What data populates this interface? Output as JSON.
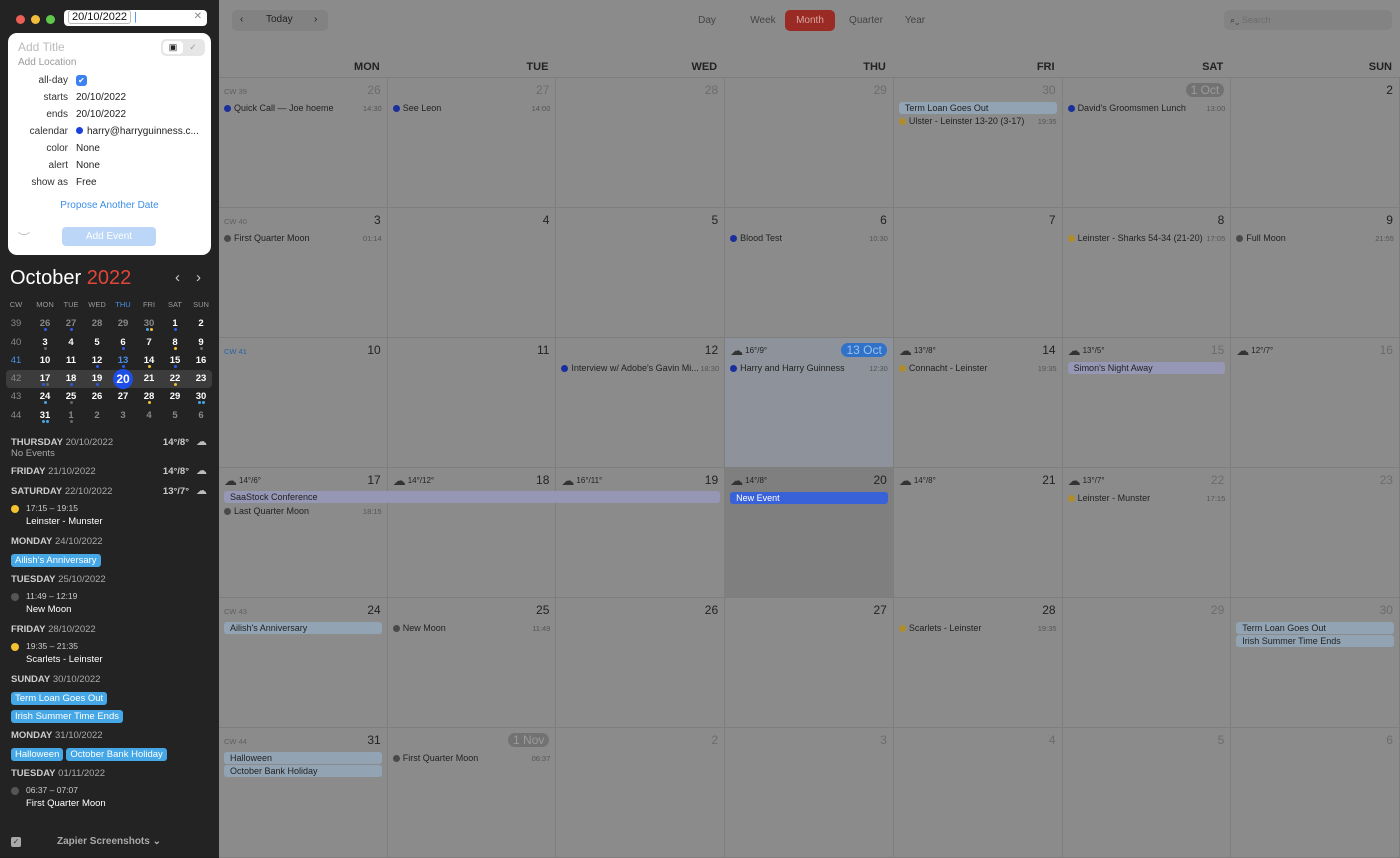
{
  "window": {
    "date_field": "20/10/2022"
  },
  "popup": {
    "title_placeholder": "Add Title",
    "location_placeholder": "Add Location",
    "fields": [
      {
        "label": "all-day",
        "value": "✔"
      },
      {
        "label": "starts",
        "value": "20/10/2022"
      },
      {
        "label": "ends",
        "value": "20/10/2022"
      },
      {
        "label": "calendar",
        "value": "harry@harryguinness.c..."
      },
      {
        "label": "color",
        "value": "None"
      },
      {
        "label": "alert",
        "value": "None"
      },
      {
        "label": "show as",
        "value": "Free"
      }
    ],
    "calendar_color": "#1a3fe0",
    "propose": "Propose Another Date",
    "add_event": "Add Event"
  },
  "mini": {
    "month": "October",
    "year": "2022",
    "headers": [
      "CW",
      "MON",
      "TUE",
      "WED",
      "THU",
      "FRI",
      "SAT",
      "SUN"
    ],
    "rows": [
      {
        "cw": "39",
        "days": [
          {
            "n": "26",
            "m": 1,
            "dots": [
              "#2f5be6"
            ]
          },
          {
            "n": "27",
            "m": 1,
            "dots": [
              "#2f5be6"
            ]
          },
          {
            "n": "28",
            "m": 1
          },
          {
            "n": "29",
            "m": 1
          },
          {
            "n": "30",
            "m": 1,
            "dots": [
              "#45a7e6",
              "#f2c230"
            ]
          },
          {
            "n": "1",
            "dots": [
              "#2f5be6"
            ]
          },
          {
            "n": "2"
          }
        ]
      },
      {
        "cw": "40",
        "days": [
          {
            "n": "3",
            "dots": [
              "#666"
            ]
          },
          {
            "n": "4"
          },
          {
            "n": "5"
          },
          {
            "n": "6",
            "dots": [
              "#2f5be6"
            ]
          },
          {
            "n": "7"
          },
          {
            "n": "8",
            "dots": [
              "#f2c230"
            ]
          },
          {
            "n": "9",
            "dots": [
              "#666"
            ]
          }
        ]
      },
      {
        "cw": "41",
        "days": [
          {
            "n": "10"
          },
          {
            "n": "11"
          },
          {
            "n": "12",
            "dots": [
              "#2f5be6"
            ]
          },
          {
            "n": "13",
            "dots": [
              "#2f5be6"
            ]
          },
          {
            "n": "14",
            "dots": [
              "#f2c230"
            ]
          },
          {
            "n": "15",
            "dots": [
              "#2f5be6"
            ]
          },
          {
            "n": "16"
          }
        ]
      },
      {
        "cw": "42",
        "days": [
          {
            "n": "17",
            "dots": [
              "#2f5be6",
              "#666"
            ]
          },
          {
            "n": "18",
            "dots": [
              "#2f5be6"
            ]
          },
          {
            "n": "19",
            "dots": [
              "#2f5be6"
            ]
          },
          {
            "n": "20",
            "sel": 1
          },
          {
            "n": "21"
          },
          {
            "n": "22",
            "dots": [
              "#f2c230"
            ]
          },
          {
            "n": "23"
          }
        ]
      },
      {
        "cw": "43",
        "days": [
          {
            "n": "24",
            "dots": [
              "#45a7e6"
            ]
          },
          {
            "n": "25",
            "dots": [
              "#666"
            ]
          },
          {
            "n": "26"
          },
          {
            "n": "27"
          },
          {
            "n": "28",
            "dots": [
              "#f2c230"
            ]
          },
          {
            "n": "29"
          },
          {
            "n": "30",
            "dots": [
              "#45a7e6",
              "#45a7e6"
            ]
          }
        ]
      },
      {
        "cw": "44",
        "days": [
          {
            "n": "31",
            "dots": [
              "#45a7e6",
              "#45a7e6"
            ]
          },
          {
            "n": "1",
            "m": 1,
            "dots": [
              "#666"
            ]
          },
          {
            "n": "2",
            "m": 1
          },
          {
            "n": "3",
            "m": 1
          },
          {
            "n": "4",
            "m": 1
          },
          {
            "n": "5",
            "m": 1
          },
          {
            "n": "6",
            "m": 1
          }
        ]
      }
    ]
  },
  "agenda": [
    {
      "day": "THURSDAY",
      "date": "20/10/2022",
      "weather": "14°/8°",
      "note": "No Events"
    },
    {
      "day": "FRIDAY",
      "date": "21/10/2022",
      "weather": "14°/8°"
    },
    {
      "day": "SATURDAY",
      "date": "22/10/2022",
      "weather": "13°/7°",
      "events": [
        {
          "time": "17:15 – 19:15",
          "title": "Leinster - Munster",
          "color": "#f2c230"
        }
      ]
    },
    {
      "day": "MONDAY",
      "date": "24/10/2022",
      "pills": [
        "Ailish's Anniversary"
      ]
    },
    {
      "day": "TUESDAY",
      "date": "25/10/2022",
      "events": [
        {
          "time": "11:49 – 12:19",
          "title": "New Moon",
          "color": "#555"
        }
      ]
    },
    {
      "day": "FRIDAY",
      "date": "28/10/2022",
      "events": [
        {
          "time": "19:35 – 21:35",
          "title": "Scarlets - Leinster",
          "color": "#f2c230"
        }
      ]
    },
    {
      "day": "SUNDAY",
      "date": "30/10/2022",
      "pills": [
        "Term Loan Goes Out",
        "Irish Summer Time Ends"
      ],
      "stack": 1
    },
    {
      "day": "MONDAY",
      "date": "31/10/2022",
      "pills": [
        "Halloween",
        "October Bank Holiday"
      ]
    },
    {
      "day": "TUESDAY",
      "date": "01/11/2022",
      "events": [
        {
          "time": "06:37 – 07:07",
          "title": "First Quarter Moon",
          "color": "#555"
        }
      ]
    }
  ],
  "footer": {
    "calendar_set": "Zapier Screenshots ⌄"
  },
  "toolbar": {
    "prev": "‹",
    "today": "Today",
    "next": "›",
    "views": [
      "Day",
      "Week",
      "Month",
      "Quarter",
      "Year"
    ],
    "active_view": "Month",
    "search_placeholder": "Search"
  },
  "weekdays": [
    "MON",
    "TUE",
    "WED",
    "THU",
    "FRI",
    "SAT",
    "SUN"
  ],
  "colors": {
    "blue": "#1a2f9c",
    "yellow": "#b08d2c",
    "gray": "#4a4a4a",
    "bar": "#92a4b3",
    "purple": "#9597b4",
    "new": "#3a62d8"
  },
  "weeks": [
    {
      "cw": "CW 39",
      "days": [
        {
          "n": "26",
          "m": 1,
          "ev": [
            {
              "c": "blue",
              "t": "Quick Call — Joe hoeme",
              "tm": "14:30"
            }
          ]
        },
        {
          "n": "27",
          "m": 1,
          "ev": [
            {
              "c": "blue",
              "t": "See Leon",
              "tm": "14:00"
            }
          ]
        },
        {
          "n": "28",
          "m": 1
        },
        {
          "n": "29",
          "m": 1
        },
        {
          "n": "30",
          "m": 1,
          "bars": [
            {
              "t": "Term Loan Goes Out",
              "c": "bar"
            }
          ],
          "ev": [
            {
              "c": "yellow",
              "t": "Ulster - Leinster 13-20 (3-17)",
              "tm": "19:35"
            }
          ]
        },
        {
          "n": "1 Oct",
          "pill": 1,
          "ev": [
            {
              "c": "blue",
              "t": "David's Groomsmen Lunch",
              "tm": "13:00"
            }
          ]
        },
        {
          "n": "2"
        }
      ]
    },
    {
      "cw": "CW 40",
      "days": [
        {
          "n": "3",
          "ev": [
            {
              "c": "gray",
              "t": "First Quarter Moon",
              "tm": "01:14"
            }
          ]
        },
        {
          "n": "4"
        },
        {
          "n": "5"
        },
        {
          "n": "6",
          "ev": [
            {
              "c": "blue",
              "t": "Blood Test",
              "tm": "10:30"
            }
          ]
        },
        {
          "n": "7"
        },
        {
          "n": "8",
          "ev": [
            {
              "c": "yellow",
              "t": "Leinster - Sharks 54-34 (21-20)",
              "tm": "17:05"
            }
          ]
        },
        {
          "n": "9",
          "ev": [
            {
              "c": "gray",
              "t": "Full Moon",
              "tm": "21:55"
            }
          ]
        }
      ]
    },
    {
      "cw": "CW 41",
      "cur": 1,
      "days": [
        {
          "n": "10"
        },
        {
          "n": "11"
        },
        {
          "n": "12",
          "ev": [
            {
              "c": "blue",
              "t": "Interview w/ Adobe's Gavin Mi...",
              "tm": "18:30"
            }
          ]
        },
        {
          "n": "13 Oct",
          "today": 1,
          "wx": "16°/9°",
          "sun": 1,
          "ev": [
            {
              "c": "blue",
              "t": "Harry and Harry Guinness",
              "tm": "12:30"
            }
          ]
        },
        {
          "n": "14",
          "wx": "13°/8°",
          "ev": [
            {
              "c": "yellow",
              "t": "Connacht - Leinster",
              "tm": "19:35"
            }
          ]
        },
        {
          "n": "15",
          "m": 1,
          "wx": "13°/5°",
          "sun": 1,
          "bars": [
            {
              "t": "Simon's Night Away",
              "c": "purple"
            }
          ]
        },
        {
          "n": "16",
          "m": 1,
          "wx": "12°/7°"
        }
      ]
    },
    {
      "cw": "",
      "span": {
        "t": "SaaStock Conference",
        "from": 0,
        "to": 2
      },
      "days": [
        {
          "n": "17",
          "wx": "14°/6°",
          "ev": [
            {
              "c": "gray",
              "t": "Last Quarter Moon",
              "tm": "18:15"
            }
          ]
        },
        {
          "n": "18",
          "wx": "14°/12°",
          "sun": 1
        },
        {
          "n": "19",
          "wx": "16°/11°",
          "norain": 1
        },
        {
          "n": "20",
          "wx": "14°/8°",
          "sel": 1,
          "bars": [
            {
              "t": "New Event",
              "c": "new"
            }
          ]
        },
        {
          "n": "21",
          "wx": "14°/8°"
        },
        {
          "n": "22",
          "m": 1,
          "wx": "13°/7°",
          "ev": [
            {
              "c": "yellow",
              "t": "Leinster - Munster",
              "tm": "17:15"
            }
          ]
        },
        {
          "n": "23",
          "m": 1
        }
      ]
    },
    {
      "cw": "CW 43",
      "days": [
        {
          "n": "24",
          "bars": [
            {
              "t": "Ailish's Anniversary",
              "c": "bar"
            }
          ]
        },
        {
          "n": "25",
          "ev": [
            {
              "c": "gray",
              "t": "New Moon",
              "tm": "11:49"
            }
          ]
        },
        {
          "n": "26"
        },
        {
          "n": "27"
        },
        {
          "n": "28",
          "ev": [
            {
              "c": "yellow",
              "t": "Scarlets - Leinster",
              "tm": "19:35"
            }
          ]
        },
        {
          "n": "29",
          "m": 1
        },
        {
          "n": "30",
          "m": 1,
          "bars": [
            {
              "t": "Term Loan Goes Out",
              "c": "bar"
            },
            {
              "t": "Irish Summer Time Ends",
              "c": "bar"
            }
          ]
        }
      ]
    },
    {
      "cw": "CW 44",
      "days": [
        {
          "n": "31",
          "bars": [
            {
              "t": "Halloween",
              "c": "bar"
            },
            {
              "t": "October Bank Holiday",
              "c": "bar"
            }
          ]
        },
        {
          "n": "1 Nov",
          "pill": 1,
          "ev": [
            {
              "c": "gray",
              "t": "First Quarter Moon",
              "tm": "06:37"
            }
          ]
        },
        {
          "n": "2",
          "m": 1
        },
        {
          "n": "3",
          "m": 1
        },
        {
          "n": "4",
          "m": 1
        },
        {
          "n": "5",
          "m": 1
        },
        {
          "n": "6",
          "m": 1
        }
      ]
    }
  ]
}
